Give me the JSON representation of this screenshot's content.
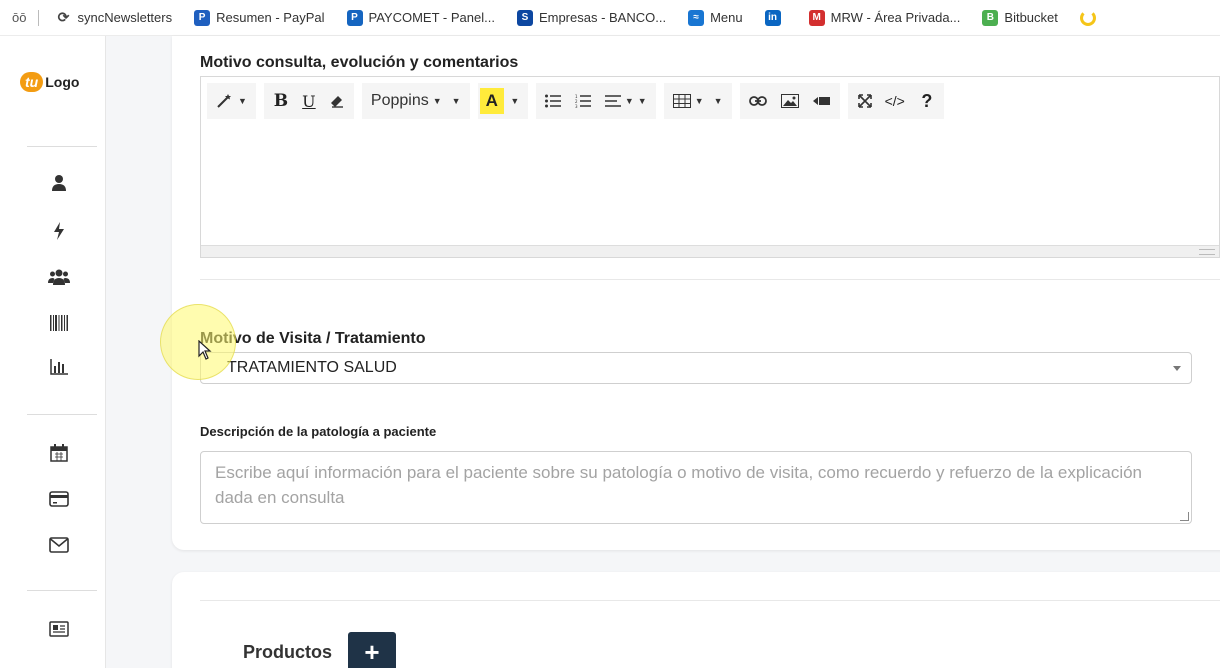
{
  "bookmarks": [
    {
      "label": "syncNewsletters",
      "color": "#444444",
      "glyph": "⟳"
    },
    {
      "label": "Resumen - PayPal",
      "color": "#1f5fbf",
      "glyph": "P"
    },
    {
      "label": "PAYCOMET - Panel...",
      "color": "#1565c0",
      "glyph": "P"
    },
    {
      "label": "Empresas - BANCO...",
      "color": "#0d47a1",
      "glyph": "S"
    },
    {
      "label": "Menu",
      "color": "#1976d2",
      "glyph": "≈"
    },
    {
      "label": "",
      "color": "#0a66c2",
      "glyph": "in"
    },
    {
      "label": "MRW - Área Privada...",
      "color": "#d32f2f",
      "glyph": "M"
    },
    {
      "label": "Bitbucket",
      "color": "#4caf50",
      "glyph": "B"
    }
  ],
  "bookmarks_prefix": "ōō",
  "logo": {
    "mark": "tu",
    "text": "Logo"
  },
  "sidebar_icons": [
    "user-icon",
    "bolt-icon",
    "users-icon",
    "barcode-icon",
    "chart-icon",
    "calendar-icon",
    "credit-card-icon",
    "envelope-icon",
    "newspaper-icon"
  ],
  "editor": {
    "label": "Motivo consulta, evolución y comentarios",
    "font_name": "Poppins",
    "content": ""
  },
  "visit": {
    "label": "Motivo de Visita / Tratamiento",
    "selected": "TRATAMIENTO SALUD"
  },
  "description": {
    "label": "Descripción de la patología a paciente",
    "placeholder": "Escribe aquí información para el paciente sobre su patología o motivo de visita, como recuerdo y refuerzo de la explicación dada en consulta"
  },
  "products": {
    "label": "Productos",
    "add_symbol": "+"
  },
  "colors": {
    "accent": "#f39c12",
    "dark_button": "#1f3347",
    "highlight": "#ffeb3b"
  }
}
